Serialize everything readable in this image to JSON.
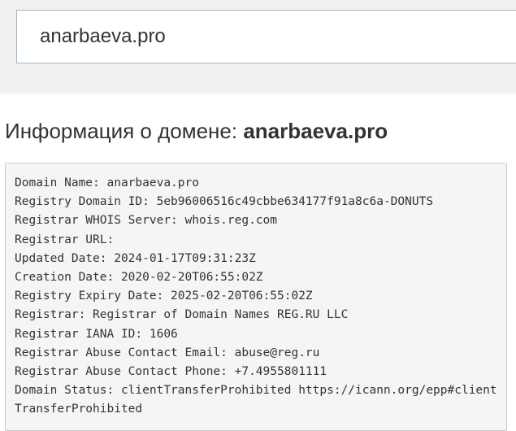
{
  "search": {
    "value": "anarbaeva.pro"
  },
  "heading": {
    "prefix": "Информация о домене: ",
    "domain": "anarbaeva.pro"
  },
  "whois": {
    "lines": [
      "Domain Name: anarbaeva.pro",
      "Registry Domain ID: 5eb96006516c49cbbe634177f91a8c6a-DONUTS",
      "Registrar WHOIS Server: whois.reg.com",
      "Registrar URL:",
      "Updated Date: 2024-01-17T09:31:23Z",
      "Creation Date: 2020-02-20T06:55:02Z",
      "Registry Expiry Date: 2025-02-20T06:55:02Z",
      "Registrar: Registrar of Domain Names REG.RU LLC",
      "Registrar IANA ID: 1606",
      "Registrar Abuse Contact Email: abuse@reg.ru",
      "Registrar Abuse Contact Phone: +7.4955801111",
      "Domain Status: clientTransferProhibited https://icann.org/epp#clientTransferProhibited"
    ]
  }
}
